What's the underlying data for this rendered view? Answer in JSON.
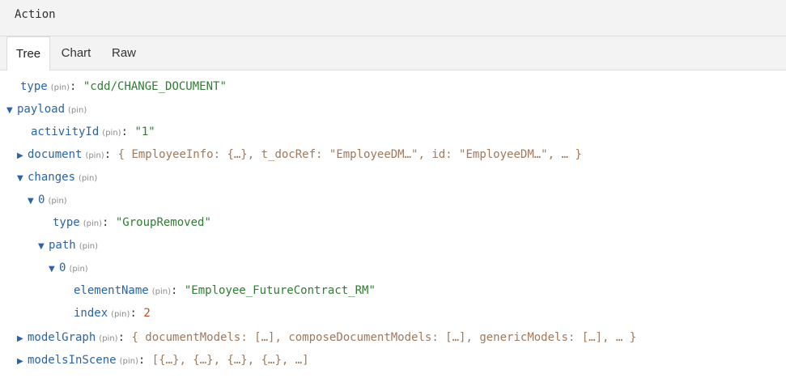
{
  "header": {
    "title": "Action"
  },
  "tabs": [
    {
      "label": "Tree",
      "active": true
    },
    {
      "label": "Chart",
      "active": false
    },
    {
      "label": "Raw",
      "active": false
    }
  ],
  "pin_label": "(pin)",
  "colon": ":",
  "arrows": {
    "expanded": "▼",
    "collapsed": "▶"
  },
  "tree": {
    "type": {
      "key": "type",
      "value": "\"cdd/CHANGE_DOCUMENT\""
    },
    "payload": {
      "key": "payload",
      "activityId": {
        "key": "activityId",
        "value": "\"1\""
      },
      "document": {
        "key": "document",
        "preview": "{ EmployeeInfo: {…}, t_docRef: \"EmployeeDM…\", id: \"EmployeeDM…\", … }"
      },
      "changes": {
        "key": "changes",
        "item0": {
          "key": "0",
          "type": {
            "key": "type",
            "value": "\"GroupRemoved\""
          },
          "path": {
            "key": "path",
            "item0": {
              "key": "0",
              "elementName": {
                "key": "elementName",
                "value": "\"Employee_FutureContract_RM\""
              },
              "index": {
                "key": "index",
                "value": "2"
              }
            }
          }
        }
      },
      "modelGraph": {
        "key": "modelGraph",
        "preview": "{ documentModels: […], composeDocumentModels: […], genericModels: […], … }"
      },
      "modelsInScene": {
        "key": "modelsInScene",
        "preview": "[{…}, {…}, {…}, {…}, …]"
      }
    }
  },
  "colors": {
    "key": "#2a63a8",
    "string": "#2e7d32",
    "number": "#c2501f",
    "preview": "#a0785c",
    "pin": "#8a8a8a"
  }
}
